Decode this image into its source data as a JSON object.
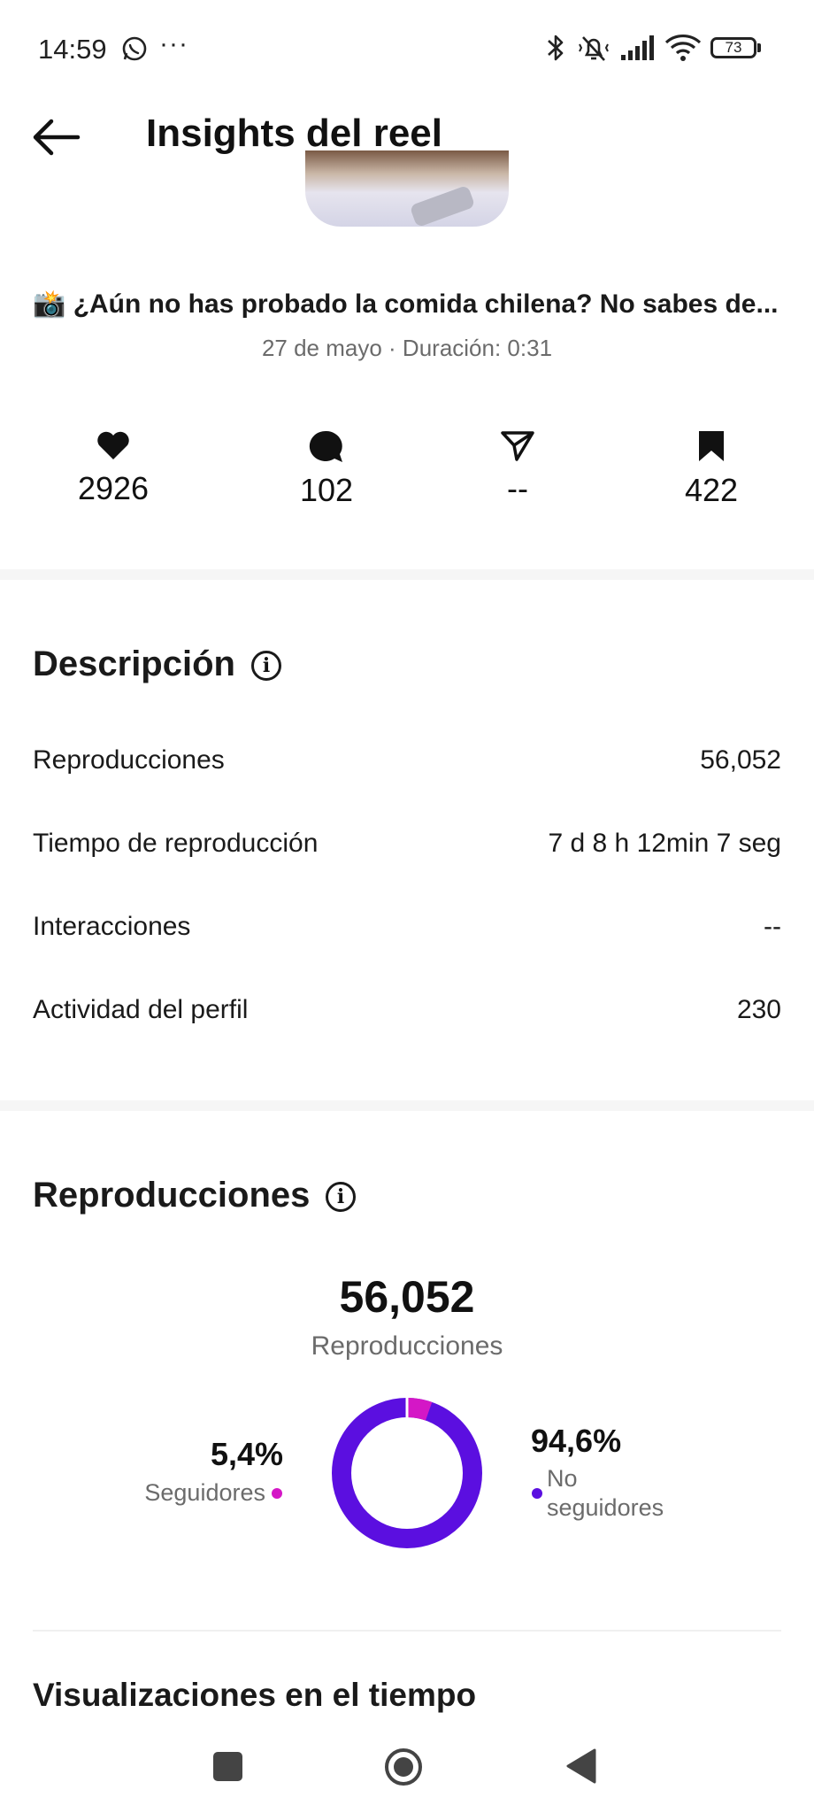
{
  "status_bar": {
    "time": "14:59",
    "app_icon": "whatsapp-icon",
    "more": "···",
    "right_icons": [
      "bluetooth-icon",
      "vibrate-silent-icon",
      "signal-icon",
      "wifi-icon"
    ],
    "battery": "73"
  },
  "header": {
    "back_icon": "arrow-left-icon",
    "title": "Insights del reel"
  },
  "reel": {
    "caption": "📸 ¿Aún no has probado la comida chilena? No sabes de...",
    "meta": "27 de mayo · Duración: 0:31"
  },
  "engagement": [
    {
      "icon": "heart-icon",
      "value": "2926"
    },
    {
      "icon": "comment-icon",
      "value": "102"
    },
    {
      "icon": "send-icon",
      "value": "--"
    },
    {
      "icon": "bookmark-icon",
      "value": "422"
    }
  ],
  "overview": {
    "title": "Descripción",
    "rows": [
      {
        "label": "Reproducciones",
        "value": "56,052"
      },
      {
        "label": "Tiempo de reproducción",
        "value": "7 d 8 h 12min 7 seg"
      },
      {
        "label": "Interacciones",
        "value": "--"
      },
      {
        "label": "Actividad del perfil",
        "value": "230"
      }
    ]
  },
  "plays": {
    "title": "Reproducciones",
    "total": "56,052",
    "total_label": "Reproducciones",
    "followers_pct": "5,4%",
    "followers_label": "Seguidores",
    "non_followers_pct": "94,6%",
    "non_followers_label_1": "No",
    "non_followers_label_2": "seguidores",
    "colors": {
      "followers": "#d417c6",
      "non_followers": "#5b0fe0"
    }
  },
  "chart_data": {
    "type": "pie",
    "categories": [
      "Seguidores",
      "No seguidores"
    ],
    "values": [
      5.4,
      94.6
    ],
    "title": "Reproducciones",
    "colors": [
      "#d417c6",
      "#5b0fe0"
    ]
  },
  "over_time": {
    "title": "Visualizaciones en el tiempo"
  },
  "nav_bar": {
    "items": [
      "recents-square-icon",
      "home-circle-icon",
      "back-triangle-icon"
    ]
  }
}
